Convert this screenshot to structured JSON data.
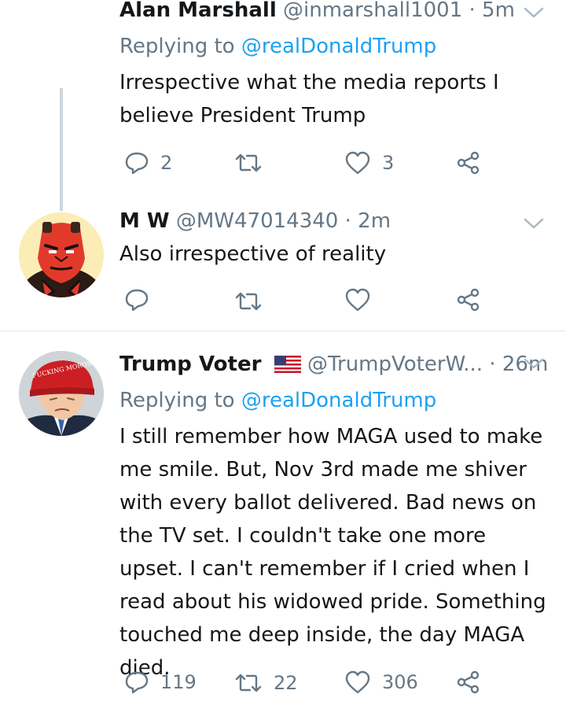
{
  "colors": {
    "text": "#14171a",
    "secondary": "#657786",
    "link": "#1da1f2",
    "divider": "#e1e8ed",
    "thread_line": "#ccd6dd"
  },
  "tweets": [
    {
      "name": "Alan Marshall",
      "handle": "@inmarshall1001",
      "dot": "·",
      "time": "5m",
      "replying_prefix": "Replying to",
      "replying_mention": "@realDonaldTrump",
      "text": "Irrespective what the media reports I believe President Trump",
      "reply_count": "2",
      "retweet_count": "",
      "like_count": "3"
    },
    {
      "name": "M W",
      "handle": "@MW47014340",
      "dot": "·",
      "time": "2m",
      "text": "Also irrespective of reality",
      "reply_count": "",
      "retweet_count": "",
      "like_count": ""
    },
    {
      "name": "Trump Voter",
      "flag": "us-flag-emoji",
      "handle": "@TrumpVoterW...",
      "dot": "·",
      "time": "26m",
      "replying_prefix": "Replying to",
      "replying_mention": "@realDonaldTrump",
      "text": "I still remember how MAGA used to make me smile. But, Nov 3rd made me shiver with every ballot delivered. Bad news on the TV set. I couldn't take one more upset. I can't remember if I cried when I read about his widowed pride. Something touched me deep inside, the day MAGA died.",
      "reply_count": "119",
      "retweet_count": "22",
      "like_count": "306",
      "avatar_hat_text": "FUCKING MORON"
    }
  ]
}
